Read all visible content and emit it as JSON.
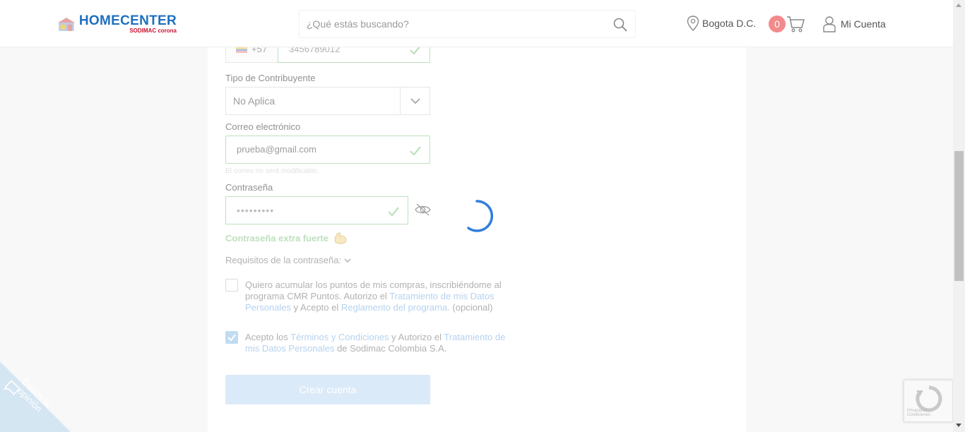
{
  "header": {
    "logo_main": "HOMECENTER",
    "logo_sub": "SODIMAC corona",
    "search_placeholder": "¿Qué estás buscando?",
    "location": "Bogota D.C.",
    "cart_count": "0",
    "account_label": "Mi Cuenta"
  },
  "form": {
    "phone_prefix": "+57",
    "phone_value": "3456789012",
    "taxpayer_label": "Tipo de Contribuyente",
    "taxpayer_value": "No Aplica",
    "email_label": "Correo electrónico",
    "email_value": "prueba@gmail.com",
    "email_hint": "El correo no será modificable.",
    "password_label": "Contraseña",
    "password_value": "•••••••••",
    "strength_text": "Contraseña extra fuerte",
    "requirements_label": "Requisitos de la contraseña:",
    "cmr_text_1": "Quiero acumular los puntos de mis compras, inscribiéndome al programa CMR Puntos. Autorizo el ",
    "cmr_link_1": "Tratamiento de mis Datos Personales",
    "cmr_text_2": " y Acepto el ",
    "cmr_link_2": "Reglamento del programa.",
    "cmr_text_3": " (opcional)",
    "cmr_checked": false,
    "terms_text_1": "Acepto los ",
    "terms_link_1": "Términos y Condiciones",
    "terms_text_2": " y Autorizo el ",
    "terms_link_2": "Tratamiento de mis Datos Personales",
    "terms_text_3": " de Sodimac Colombia S.A.",
    "terms_checked": true,
    "submit_label": "Crear cuenta"
  },
  "feedback_tab": {
    "label_line1": "Danos tu",
    "label_line2": "opinión"
  },
  "recaptcha": {
    "footer": "Privacidad - Condiciones"
  },
  "colors": {
    "brand_blue": "#1f6fbf",
    "valid_green": "#9ccf9c",
    "button_disabled": "#c8dff5",
    "spinner_blue": "#2f7de1",
    "cart_badge": "#f38a8a"
  }
}
